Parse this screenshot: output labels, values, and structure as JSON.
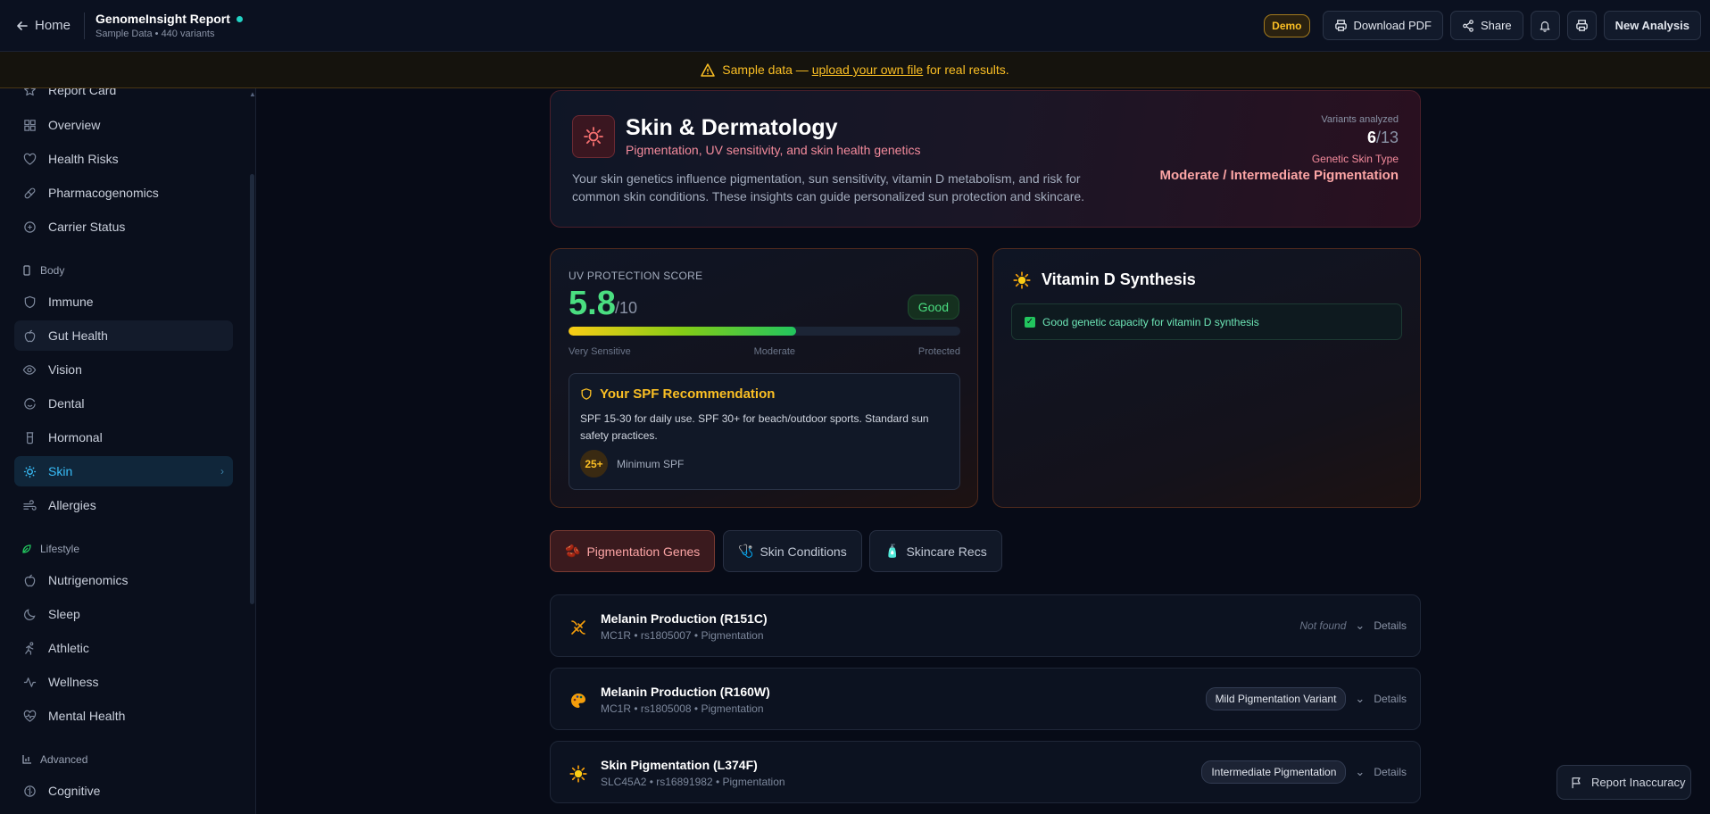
{
  "topbar": {
    "home_label": "Home",
    "title": "GenomeInsight Report",
    "subtitle": "Sample Data • 440 variants",
    "demo_badge": "Demo",
    "download_label": "Download PDF",
    "share_label": "Share",
    "new_analysis_label": "New Analysis"
  },
  "banner": {
    "prefix": "Sample data — ",
    "link": "upload your own file",
    "suffix": " for real results."
  },
  "sidebar": {
    "items": [
      {
        "label": "Report Card",
        "icon": "star-icon"
      },
      {
        "label": "Overview",
        "icon": "grid-icon"
      },
      {
        "label": "Health Risks",
        "icon": "heart-icon"
      },
      {
        "label": "Pharmacogenomics",
        "icon": "pill-icon"
      },
      {
        "label": "Carrier Status",
        "icon": "shield-icon"
      },
      {
        "label": "Immune",
        "icon": "shield-icon"
      },
      {
        "label": "Gut Health",
        "icon": "apple-icon"
      },
      {
        "label": "Vision",
        "icon": "eye-icon"
      },
      {
        "label": "Dental",
        "icon": "smile-icon"
      },
      {
        "label": "Hormonal",
        "icon": "flask-icon"
      },
      {
        "label": "Skin",
        "icon": "sun-icon"
      },
      {
        "label": "Allergies",
        "icon": "wind-icon"
      },
      {
        "label": "Nutrigenomics",
        "icon": "apple-icon"
      },
      {
        "label": "Sleep",
        "icon": "moon-icon"
      },
      {
        "label": "Athletic",
        "icon": "run-icon"
      },
      {
        "label": "Wellness",
        "icon": "pulse-icon"
      },
      {
        "label": "Mental Health",
        "icon": "heart-pulse-icon"
      },
      {
        "label": "Cognitive",
        "icon": "brain-icon"
      }
    ],
    "sections": {
      "body": "Body",
      "lifestyle": "Lifestyle",
      "advanced": "Advanced"
    }
  },
  "hero": {
    "title": "Skin & Dermatology",
    "subtitle": "Pigmentation, UV sensitivity, and skin health genetics",
    "description": "Your skin genetics influence pigmentation, sun sensitivity, vitamin D metabolism, and risk for common skin conditions. These insights can guide personalized sun protection and skincare.",
    "variants_label": "Variants analyzed",
    "variants_found": "6",
    "variants_total": "/13",
    "skin_type_label": "Genetic Skin Type",
    "skin_type_value": "Moderate / Intermediate Pigmentation"
  },
  "uv": {
    "label": "UV PROTECTION SCORE",
    "score": "5.8",
    "score_max": "/10",
    "score_fraction": 0.58,
    "badge": "Good",
    "scale": [
      "Very Sensitive",
      "Moderate",
      "Protected"
    ],
    "spf_title": "Your SPF Recommendation",
    "spf_text": "SPF 15-30 for daily use. SPF 30+ for beach/outdoor sports. Standard sun safety practices.",
    "spf_min_value": "25+",
    "spf_min_label": "Minimum SPF"
  },
  "vitamin_d": {
    "title": "Vitamin D Synthesis",
    "note": "Good genetic capacity for vitamin D synthesis"
  },
  "tabs": [
    {
      "label": "Pigmentation Genes",
      "icon": "🫘"
    },
    {
      "label": "Skin Conditions",
      "icon": "🩺"
    },
    {
      "label": "Skincare Recs",
      "icon": "🧴"
    }
  ],
  "genes": [
    {
      "name": "Melanin Production (R151C)",
      "meta": "MC1R • rs1805007 • Pigmentation",
      "status": "Not found",
      "details": "Details",
      "icon": "dna-icon"
    },
    {
      "name": "Melanin Production (R160W)",
      "meta": "MC1R • rs1805008 • Pigmentation",
      "status": "Mild Pigmentation Variant",
      "details": "Details",
      "icon": "palette-icon"
    },
    {
      "name": "Skin Pigmentation (L374F)",
      "meta": "SLC45A2 • rs16891982 • Pigmentation",
      "status": "Intermediate Pigmentation",
      "details": "Details",
      "icon": "sun-icon"
    }
  ],
  "report_inaccuracy": "Report Inaccuracy",
  "colors": {
    "accent": "#38bdf8",
    "good": "#4ade80",
    "warning": "#fbbf24",
    "skin": "#f48b9c"
  }
}
